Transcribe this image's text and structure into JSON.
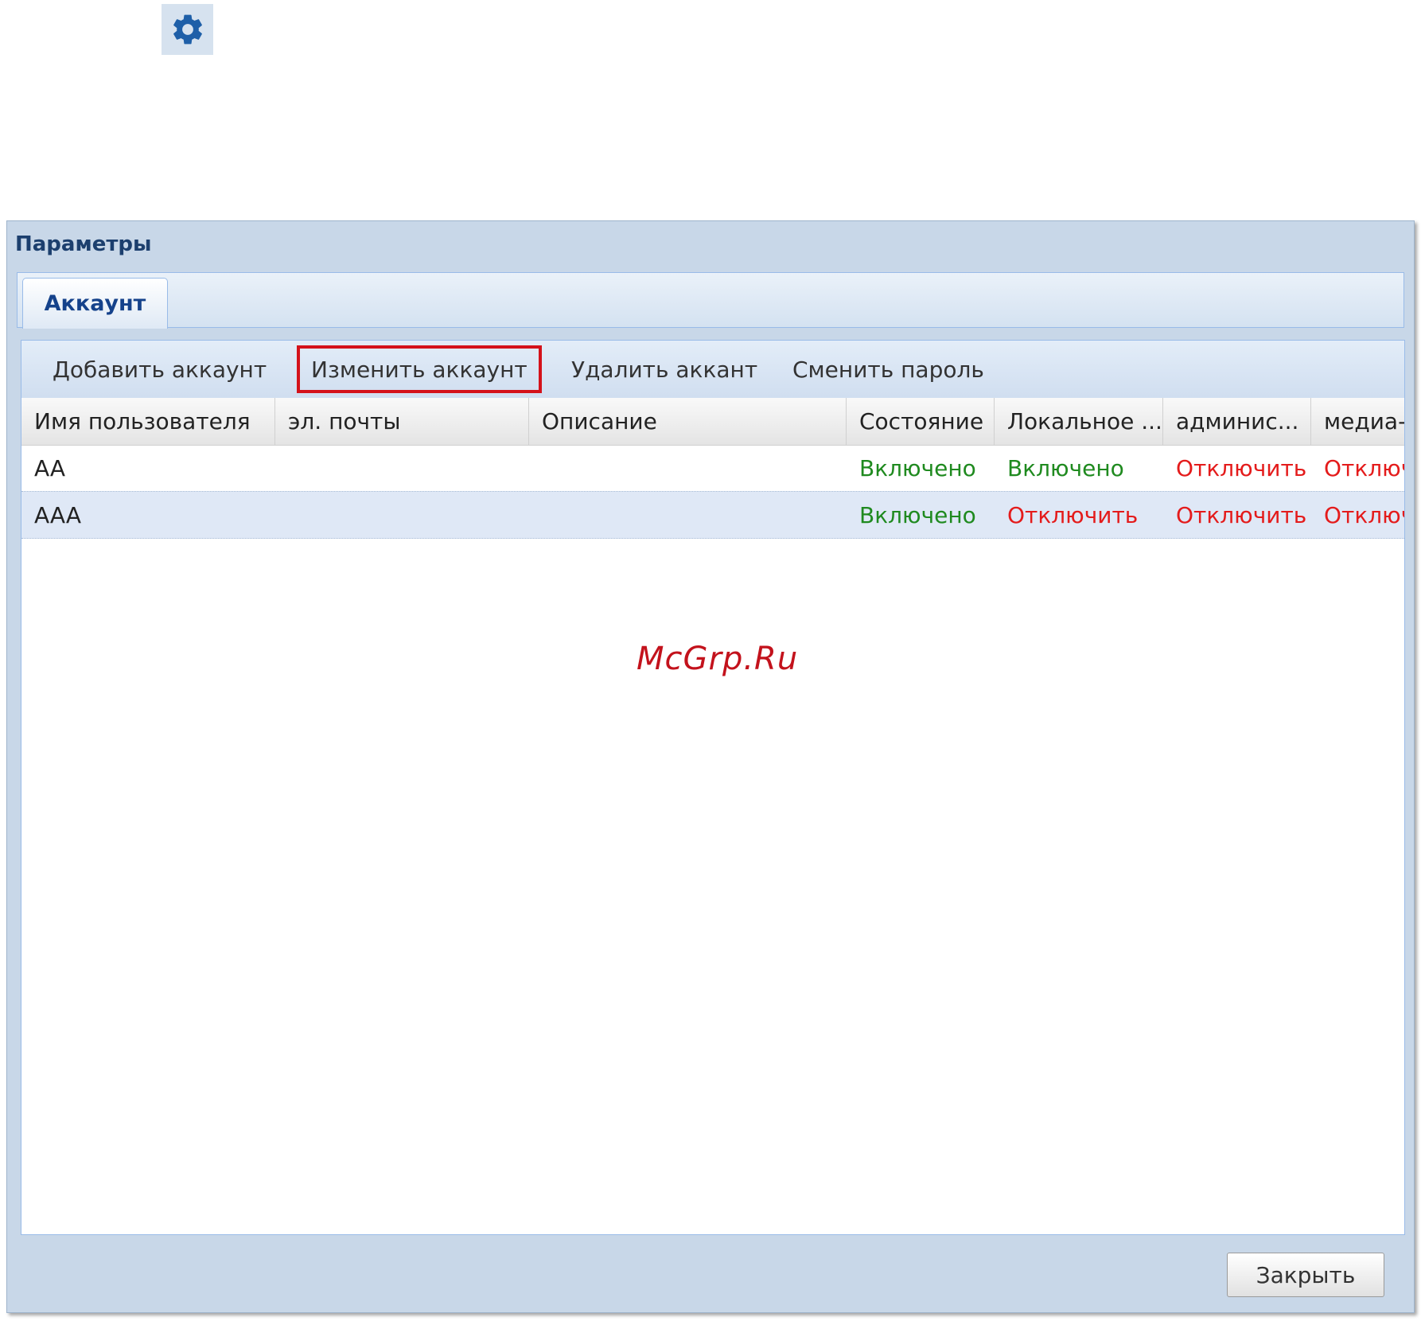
{
  "dialog": {
    "title": "Параметры",
    "tabs": [
      {
        "label": "Аккаунт",
        "active": true
      }
    ],
    "close_label": "Закрыть"
  },
  "toolbar": {
    "add_label": "Добавить аккаунт",
    "edit_label": "Изменить аккаунт",
    "delete_label": "Удалить аккант",
    "change_password_label": "Сменить пароль",
    "highlight_color": "#d4121a"
  },
  "grid": {
    "columns": [
      "Имя пользователя",
      "эл. почты",
      "Описание",
      "Состояние",
      "Локальное ...",
      "админис...",
      "медиа-"
    ],
    "rows": [
      {
        "username": "AA",
        "email": "",
        "description": "",
        "state": "Включено",
        "local": "Включено",
        "admin": "Отключить",
        "media": "Отключить",
        "selected": false
      },
      {
        "username": "AAA",
        "email": "",
        "description": "",
        "state": "Включено",
        "local": "Отключить",
        "admin": "Отключить",
        "media": "Отключить",
        "selected": true
      }
    ],
    "status_colors": {
      "enabled": "#1f8a1f",
      "disabled": "#e41b1b"
    }
  },
  "watermark": "McGrp.Ru",
  "icons": {
    "settings": "gear-icon"
  }
}
